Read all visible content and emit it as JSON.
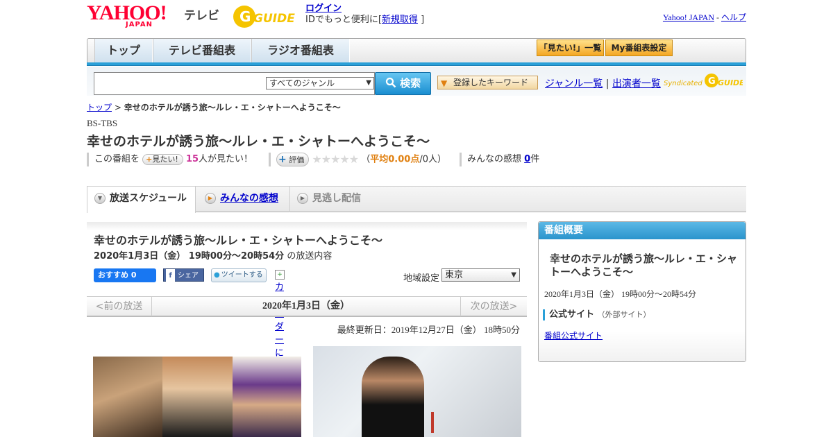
{
  "header": {
    "logo_yahoo": "YAHOO!",
    "logo_japan": "JAPAN",
    "logo_tv": "テレビ",
    "logo_gguide": "G GUIDE",
    "login_label": "ログイン",
    "login_sub_prefix": "IDでもっと便利に[",
    "register_label": "新規取得",
    "login_sub_suffix": "]",
    "yahoo_japan_link": "Yahoo! JAPAN",
    "separator": "-",
    "help_link": "ヘルプ"
  },
  "nav": {
    "tabs": [
      {
        "label": "トップ"
      },
      {
        "label": "テレビ番組表"
      },
      {
        "label": "ラジオ番組表"
      }
    ],
    "mitai_list": "「見たい!」一覧",
    "my_bangumi": "My番組表設定"
  },
  "search": {
    "input_value": "",
    "genre_selected": "すべてのジャンル",
    "search_button": "検索",
    "keyword_button": "登録したキーワード",
    "genre_list": "ジャンル一覧",
    "divider": "|",
    "performer_list": "出演者一覧",
    "syndicated": "Syndicated"
  },
  "breadcrumb": {
    "top": "トップ",
    "sep": ">",
    "current": "幸せのホテルが誘う旅～ルレ・エ・シャトーへようこそ～"
  },
  "program": {
    "channel": "BS-TBS",
    "title": "幸せのホテルが誘う旅～ルレ・エ・シャトーへようこそ～",
    "this_program": "この番組を",
    "mitai_button": "見たい!",
    "mitai_count": "15",
    "mitai_suffix": "人が見たい！",
    "hyoka_button": "評価",
    "stars": "★★★★★",
    "avg_prefix": "（",
    "avg_label": "平均0.00点",
    "avg_suffix": "/0人）",
    "kansou_label": "みんなの感想",
    "kansou_count": "0",
    "kansou_suffix": "件"
  },
  "tabs": [
    {
      "label": "放送スケジュール"
    },
    {
      "label": "みんなの感想"
    },
    {
      "label": "見逃し配信"
    }
  ],
  "main": {
    "title": "幸せのホテルが誘う旅～ルレ・エ・シャトーへようこそ～",
    "date_bold": "2020年1月3日（金） 19時00分～20時54分",
    "date_suffix": "の放送内容",
    "fb_recommend": "おすすめ 0",
    "fb_share": "シェア",
    "tweet": "ツイートする",
    "calendar": "カレンダーに登録",
    "region_label": "地域設定",
    "region_selected": "東京",
    "prev": "<前の放送",
    "current_date": "2020年1月3日（金）",
    "next": "次の放送>",
    "updated": "最終更新日：2019年12月27日（金） 18時50分"
  },
  "side": {
    "header": "番組概要",
    "title": "幸せのホテルが誘う旅～ルレ・エ・シャトーへようこそ～",
    "date": "2020年1月3日（金） 19時00分～20時54分",
    "official_label": "公式サイト",
    "official_ext": "（外部サイト）",
    "official_link": "番組公式サイト"
  }
}
